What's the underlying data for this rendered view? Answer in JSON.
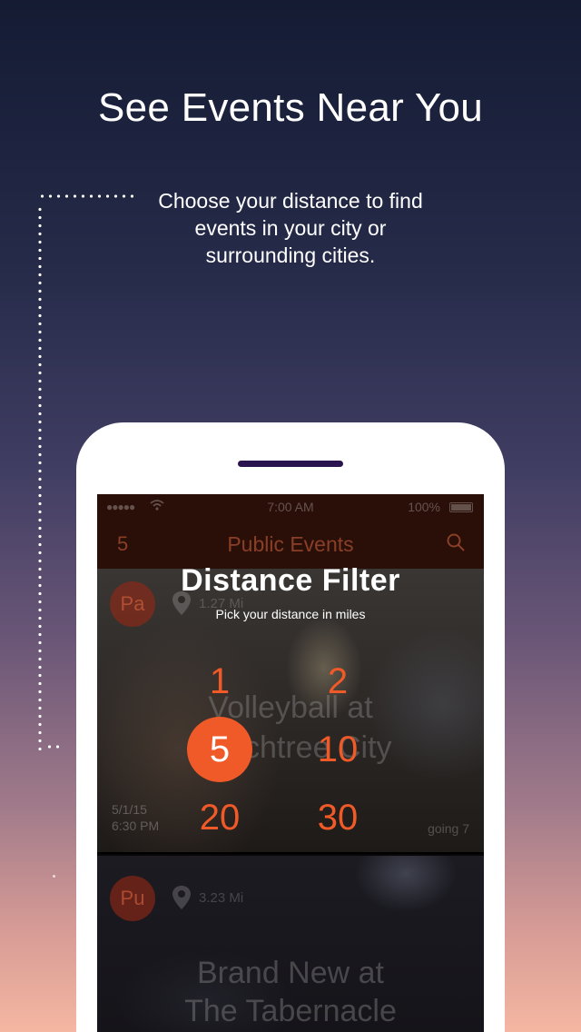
{
  "headline": "See Events Near You",
  "description": "Choose your distance to find events in your city or surrounding cities.",
  "phone": {
    "statusbar": {
      "signal": "●●●●●",
      "time": "7:00 AM",
      "battery": "100%"
    },
    "navbar": {
      "count": "5",
      "title": "Public Events"
    },
    "filter": {
      "title": "Distance Filter",
      "subtitle": "Pick your distance in miles",
      "options": [
        "1",
        "2",
        "5",
        "10",
        "20",
        "30"
      ],
      "selected": "5"
    },
    "events": [
      {
        "avatar": "Pa",
        "distance": "1.27 Mi",
        "title_line1": "Volleyball at",
        "title_line2": "Peachtree City",
        "date": "5/1/15",
        "time": "6:30 PM",
        "going": "going  7"
      },
      {
        "avatar": "Pu",
        "distance": "3.23 Mi",
        "title_line1": "Brand New at",
        "title_line2": "The Tabernacle"
      }
    ]
  },
  "colors": {
    "accent": "#f05a28",
    "speaker": "#2a1450",
    "navbar": "#2a0e08"
  },
  "icons": [
    "wifi-icon",
    "battery-icon",
    "search-icon",
    "location-pin-icon"
  ]
}
